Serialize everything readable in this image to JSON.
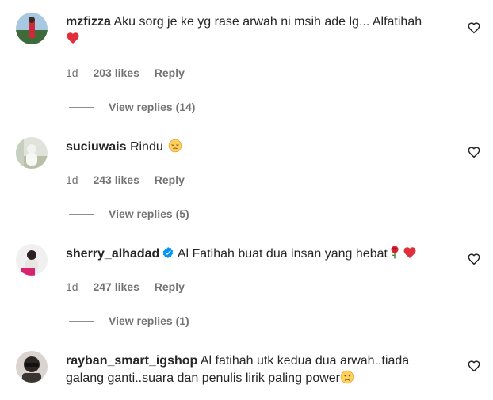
{
  "comments": [
    {
      "username": "mzfizza",
      "text": "Aku sorg je ke yg rase arwah ni msih ade lg... Alfatihah",
      "time": "1d",
      "likes": "203 likes",
      "reply": "Reply",
      "view_replies": "View replies (14)",
      "emoji": [
        "red-heart"
      ]
    },
    {
      "username": "suciuwais",
      "text": "Rindu",
      "time": "1d",
      "likes": "243 likes",
      "reply": "Reply",
      "view_replies": "View replies (5)",
      "emoji": [
        "pensive-face"
      ]
    },
    {
      "username": "sherry_alhadad",
      "verified": true,
      "text": "Al Fatihah buat dua insan yang hebat",
      "time": "1d",
      "likes": "247 likes",
      "reply": "Reply",
      "view_replies": "View replies (1)",
      "emoji": [
        "rose",
        "red-heart"
      ]
    },
    {
      "username": "rayban_smart_igshop",
      "text": "Al fatihah utk kedua dua arwah..tiada galang ganti..suara dan penulis lirik paling power",
      "emoji": [
        "crying-face"
      ]
    }
  ],
  "colors": {
    "text": "#262626",
    "muted": "#737373",
    "verified": "#0095f6",
    "heart": "#e0245e"
  }
}
